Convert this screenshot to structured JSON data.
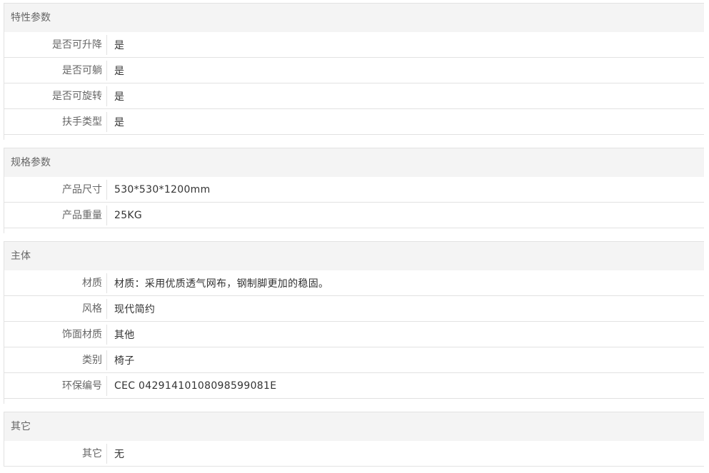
{
  "sections": [
    {
      "title": "特性参数",
      "rows": [
        {
          "label": "是否可升降",
          "value": "是"
        },
        {
          "label": "是否可躺",
          "value": "是"
        },
        {
          "label": "是否可旋转",
          "value": "是"
        },
        {
          "label": "扶手类型",
          "value": "是"
        }
      ]
    },
    {
      "title": "规格参数",
      "rows": [
        {
          "label": "产品尺寸",
          "value": "530*530*1200mm"
        },
        {
          "label": "产品重量",
          "value": "25KG"
        }
      ]
    },
    {
      "title": "主体",
      "rows": [
        {
          "label": "材质",
          "value": "材质：采用优质透气网布，钢制脚更加的稳固。"
        },
        {
          "label": "风格",
          "value": "现代简约"
        },
        {
          "label": "饰面材质",
          "value": "其他"
        },
        {
          "label": "类别",
          "value": "椅子"
        },
        {
          "label": "环保编号",
          "value": "CEC 04291410108098599081E"
        }
      ]
    },
    {
      "title": "其它",
      "rows": [
        {
          "label": "其它",
          "value": "无"
        }
      ]
    }
  ]
}
